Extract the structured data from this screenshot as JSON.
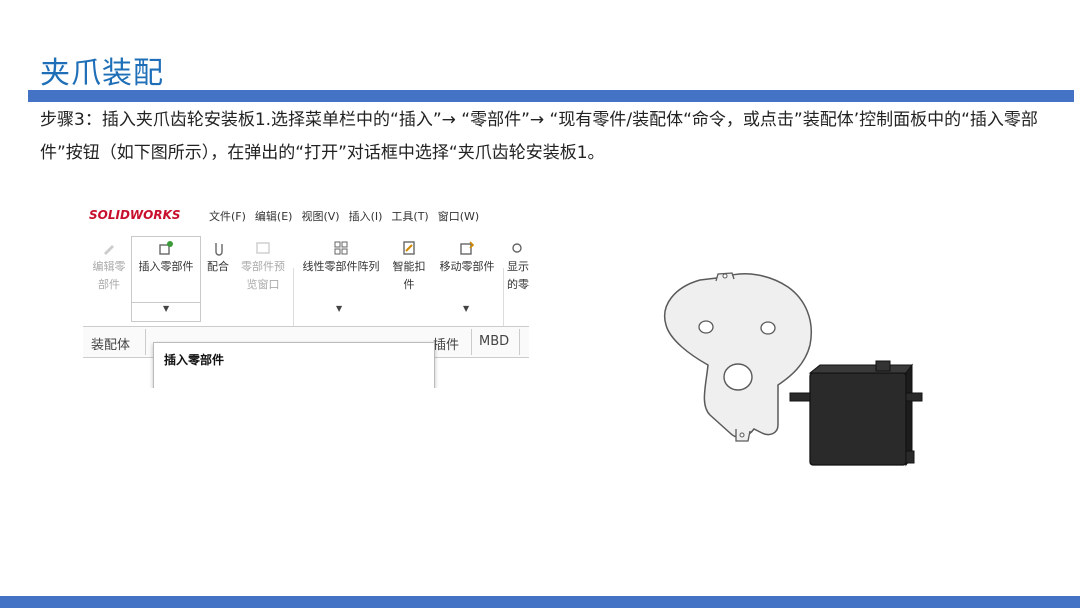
{
  "slide": {
    "title": "夹爪装配",
    "paragraph": "步骤3：插入夹爪齿轮安装板1.选择菜单栏中的“插入”→ “零部件”→ “现有零件/装配体“命令，或点击”装配体’控制面板中的“插入零部件”按钮（如下图所示），在弹出的“打开”对话框中选择“夹爪齿轮安装板1。"
  },
  "solidworks": {
    "logo": "SOLIDWORKS",
    "menu": [
      "文件(F)",
      "编辑(E)",
      "视图(V)",
      "插入(I)",
      "工具(T)",
      "窗口(W)"
    ],
    "ribbon": {
      "edit_part": [
        "编辑零",
        "部件"
      ],
      "insert_part": "插入零部件",
      "mate": "配合",
      "component_preview": [
        "零部件预",
        "览窗口"
      ],
      "linear_pattern": "线性零部件阵列",
      "smart_fastener": [
        "智能扣",
        "件"
      ],
      "move_component": "移动零部件",
      "show_hidden": [
        "显示",
        "的零"
      ]
    },
    "tabs": [
      "装配体",
      "插件",
      "MBD"
    ],
    "tooltip": "插入零部件"
  },
  "colors": {
    "title": "#1e6fb8",
    "bar": "#4472c4",
    "plate": "#efefef",
    "servo": "#2a2a2a"
  }
}
